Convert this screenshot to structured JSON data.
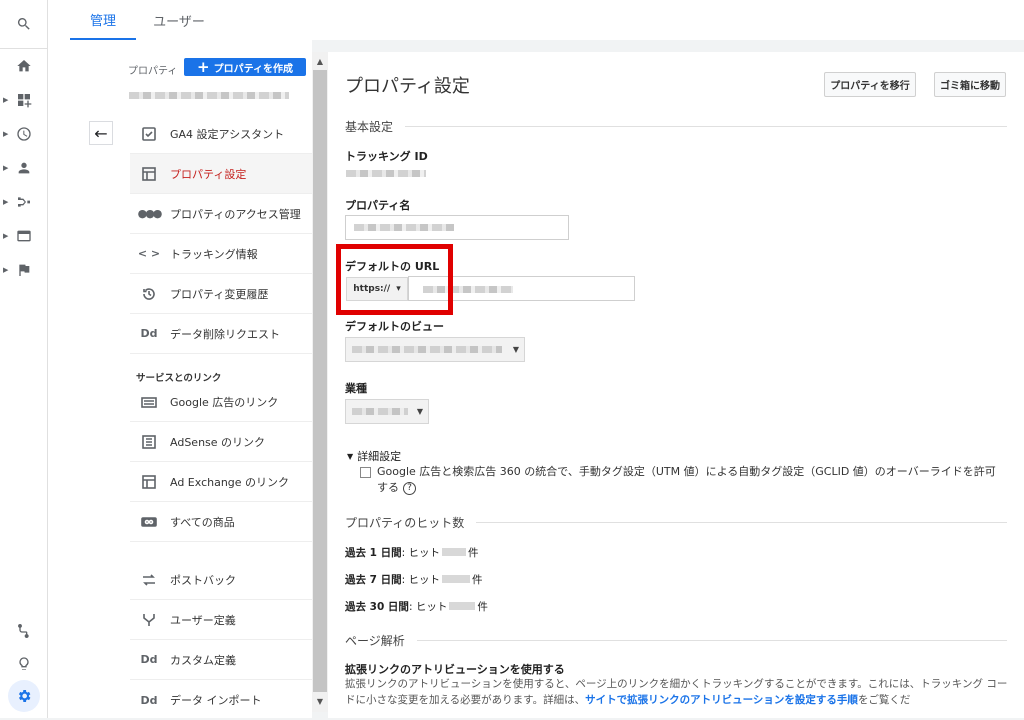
{
  "tabs": {
    "admin": "管理",
    "users": "ユーザー"
  },
  "property_column": {
    "label": "プロパティ",
    "create_button": "プロパティを作成",
    "nav_items": [
      {
        "label": "GA4 設定アシスタント",
        "icon": "checklist-icon"
      },
      {
        "label": "プロパティ設定",
        "icon": "property-settings-icon"
      },
      {
        "label": "プロパティのアクセス管理",
        "icon": "people-icon"
      },
      {
        "label": "トラッキング情報",
        "icon": "code-icon"
      },
      {
        "label": "プロパティ変更履歴",
        "icon": "history-icon"
      },
      {
        "label": "データ削除リクエスト",
        "icon": "dd-icon"
      }
    ],
    "links_section": "サービスとのリンク",
    "link_items": [
      {
        "label": "Google 広告のリンク",
        "icon": "ads-icon"
      },
      {
        "label": "AdSense のリンク",
        "icon": "adsense-icon"
      },
      {
        "label": "Ad Exchange のリンク",
        "icon": "adexchange-icon"
      },
      {
        "label": "すべての商品",
        "icon": "link-icon"
      },
      {
        "label": "ポストバック",
        "icon": "postback-icon"
      },
      {
        "label": "ユーザー定義",
        "icon": "fork-icon"
      },
      {
        "label": "カスタム定義",
        "icon": "dd-icon"
      },
      {
        "label": "データ インポート",
        "icon": "dd-icon"
      }
    ]
  },
  "main": {
    "title": "プロパティ設定",
    "move_button": "プロパティを移行",
    "trash_button": "ゴミ箱に移動",
    "basic_section": "基本設定",
    "tracking_id_label": "トラッキング ID",
    "property_name_label": "プロパティ名",
    "default_url_label": "デフォルトの URL",
    "protocol_value": "https://",
    "default_view_label": "デフォルトのビュー",
    "industry_label": "業種",
    "advanced_label": "詳細設定",
    "override_text": "Google 広告と検索広告 360 の統合で、手動タグ設定（UTM 値）による自動タグ設定（GCLID 値）のオーバーライドを許可する",
    "hits_section": "プロパティのヒット数",
    "hits": [
      {
        "period": "過去 1 日間",
        "text": ": ヒット",
        "unit": "件"
      },
      {
        "period": "過去 7 日間",
        "text": ": ヒット",
        "unit": "件"
      },
      {
        "period": "過去 30 日間",
        "text": ": ヒット",
        "unit": "件"
      }
    ],
    "page_analysis_section": "ページ解析",
    "enhanced_link_label": "拡張リンクのアトリビューションを使用する",
    "enhanced_link_desc_1": "拡張リンクのアトリビューションを使用すると、ページ上のリンクを細かくトラッキングすることができます。これには、トラッキング コードに小さな変更を加える必要があります。詳細は、",
    "enhanced_link_link": "サイトで拡張リンクのアトリビューションを設定する手順",
    "enhanced_link_desc_2": "をご覧くだ"
  },
  "colors": {
    "accent": "#1a73e8",
    "highlight": "#e00000",
    "selected_text": "#c5221f"
  }
}
